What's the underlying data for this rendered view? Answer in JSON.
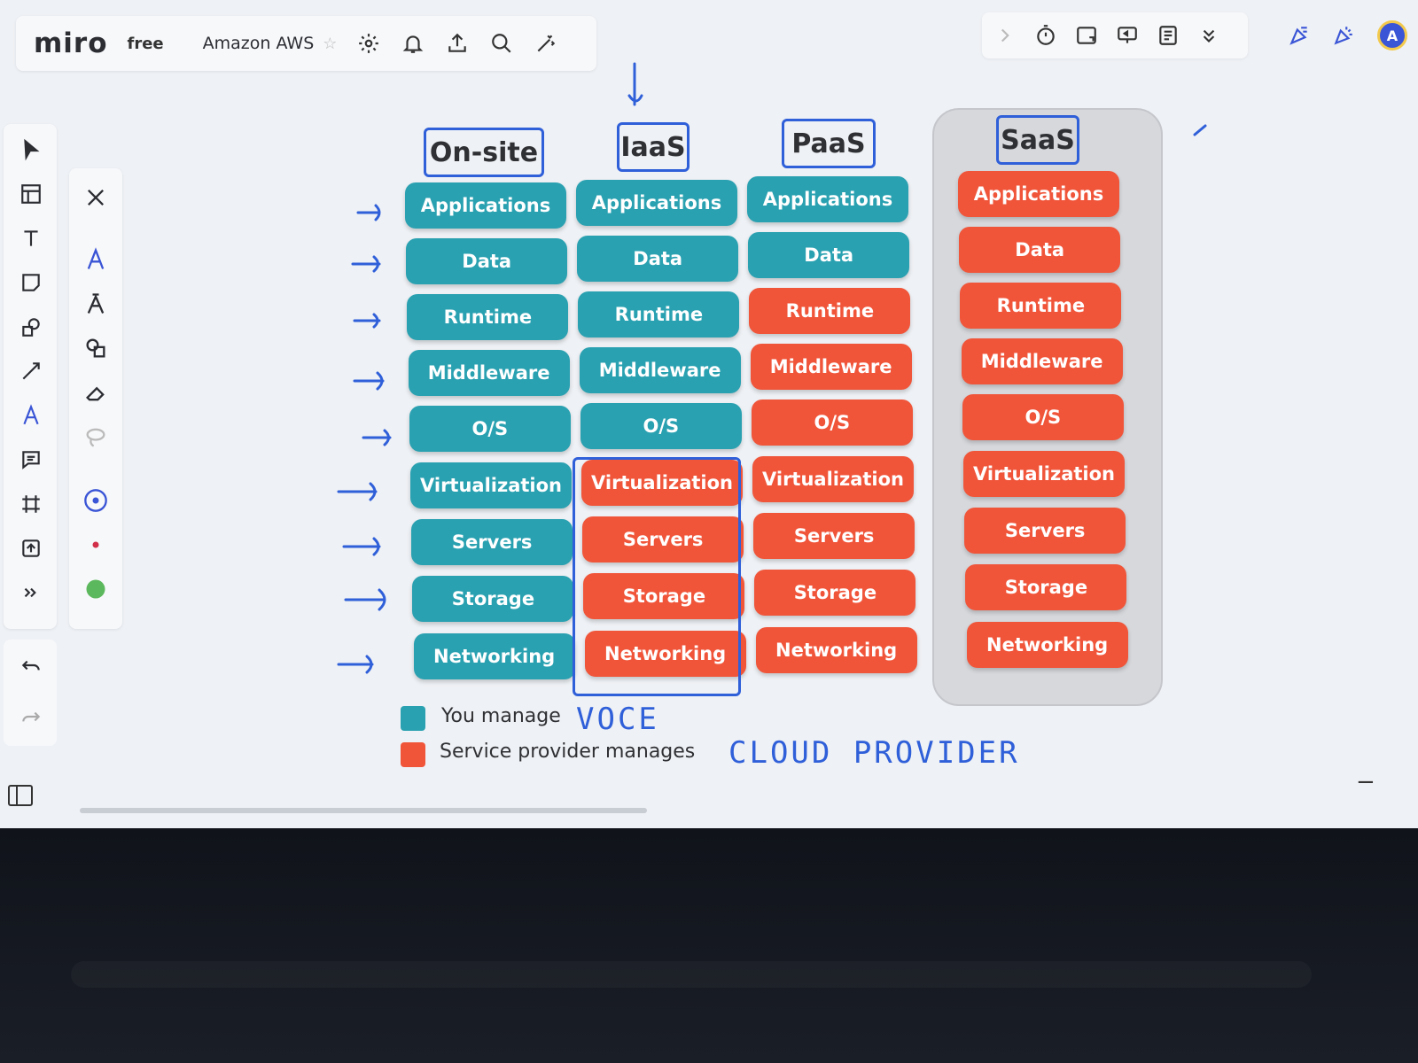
{
  "app": {
    "logo": "miro",
    "plan": "free",
    "board_name": "Amazon AWS",
    "avatar_initial": "A"
  },
  "topbar_icons": [
    "settings-icon",
    "bell-icon",
    "share-icon",
    "search-icon",
    "magic-icon"
  ],
  "topright_icons": [
    "timer-icon",
    "card-icon",
    "present-icon",
    "notes-icon",
    "more-icon"
  ],
  "columns": [
    {
      "title": "On-site",
      "rows": [
        {
          "label": "Applications",
          "manager": "you"
        },
        {
          "label": "Data",
          "manager": "you"
        },
        {
          "label": "Runtime",
          "manager": "you"
        },
        {
          "label": "Middleware",
          "manager": "you"
        },
        {
          "label": "O/S",
          "manager": "you"
        },
        {
          "label": "Virtualization",
          "manager": "you"
        },
        {
          "label": "Servers",
          "manager": "you"
        },
        {
          "label": "Storage",
          "manager": "you"
        },
        {
          "label": "Networking",
          "manager": "you"
        }
      ]
    },
    {
      "title": "IaaS",
      "rows": [
        {
          "label": "Applications",
          "manager": "you"
        },
        {
          "label": "Data",
          "manager": "you"
        },
        {
          "label": "Runtime",
          "manager": "you"
        },
        {
          "label": "Middleware",
          "manager": "you"
        },
        {
          "label": "O/S",
          "manager": "you"
        },
        {
          "label": "Virtualization",
          "manager": "provider"
        },
        {
          "label": "Servers",
          "manager": "provider"
        },
        {
          "label": "Storage",
          "manager": "provider"
        },
        {
          "label": "Networking",
          "manager": "provider"
        }
      ]
    },
    {
      "title": "PaaS",
      "rows": [
        {
          "label": "Applications",
          "manager": "you"
        },
        {
          "label": "Data",
          "manager": "you"
        },
        {
          "label": "Runtime",
          "manager": "provider"
        },
        {
          "label": "Middleware",
          "manager": "provider"
        },
        {
          "label": "O/S",
          "manager": "provider"
        },
        {
          "label": "Virtualization",
          "manager": "provider"
        },
        {
          "label": "Servers",
          "manager": "provider"
        },
        {
          "label": "Storage",
          "manager": "provider"
        },
        {
          "label": "Networking",
          "manager": "provider"
        }
      ]
    },
    {
      "title": "SaaS",
      "rows": [
        {
          "label": "Applications",
          "manager": "provider"
        },
        {
          "label": "Data",
          "manager": "provider"
        },
        {
          "label": "Runtime",
          "manager": "provider"
        },
        {
          "label": "Middleware",
          "manager": "provider"
        },
        {
          "label": "O/S",
          "manager": "provider"
        },
        {
          "label": "Virtualization",
          "manager": "provider"
        },
        {
          "label": "Servers",
          "manager": "provider"
        },
        {
          "label": "Storage",
          "manager": "provider"
        },
        {
          "label": "Networking",
          "manager": "provider"
        }
      ]
    }
  ],
  "legend": {
    "you": {
      "label": "You manage",
      "color": "#2aa1b1",
      "handwritten": "VOCE"
    },
    "provider": {
      "label": "Service provider manages",
      "color": "#f0553a",
      "handwritten": "CLOUD PROVIDER"
    }
  },
  "colors": {
    "accent": "#3a55d6",
    "annotation": "#2f5fd9"
  }
}
